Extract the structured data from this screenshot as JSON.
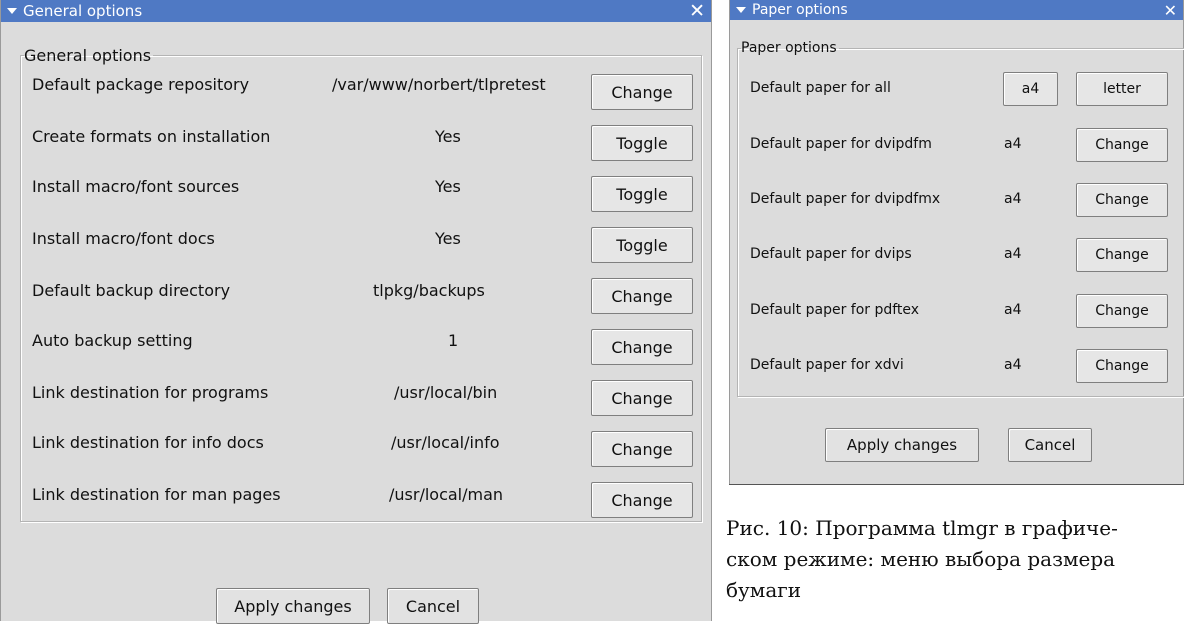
{
  "general_window": {
    "title": "General options",
    "close_glyph": "✕",
    "group_label": "General options",
    "rows": [
      {
        "label": "Default package repository",
        "value": "/var/www/norbert/tlpretest",
        "button": "Change"
      },
      {
        "label": "Create formats on installation",
        "value": "Yes",
        "button": "Toggle"
      },
      {
        "label": "Install macro/font sources",
        "value": "Yes",
        "button": "Toggle"
      },
      {
        "label": "Install macro/font docs",
        "value": "Yes",
        "button": "Toggle"
      },
      {
        "label": "Default backup directory",
        "value": "tlpkg/backups",
        "button": "Change"
      },
      {
        "label": "Auto backup setting",
        "value": "1",
        "button": "Change"
      },
      {
        "label": "Link destination for programs",
        "value": "/usr/local/bin",
        "button": "Change"
      },
      {
        "label": "Link destination for info docs",
        "value": "/usr/local/info",
        "button": "Change"
      },
      {
        "label": "Link destination for man pages",
        "value": "/usr/local/man",
        "button": "Change"
      }
    ],
    "apply_label": "Apply changes",
    "cancel_label": "Cancel"
  },
  "paper_window": {
    "title": "Paper options",
    "close_glyph": "✕",
    "group_label": "Paper options",
    "all_row": {
      "label": "Default paper for all",
      "option_a": "a4",
      "option_b": "letter"
    },
    "rows": [
      {
        "label": "Default paper for dvipdfm",
        "value": "a4",
        "button": "Change"
      },
      {
        "label": "Default paper for dvipdfmx",
        "value": "a4",
        "button": "Change"
      },
      {
        "label": "Default paper for dvips",
        "value": "a4",
        "button": "Change"
      },
      {
        "label": "Default paper for pdftex",
        "value": "a4",
        "button": "Change"
      },
      {
        "label": "Default paper for xdvi",
        "value": "a4",
        "button": "Change"
      }
    ],
    "apply_label": "Apply changes",
    "cancel_label": "Cancel"
  },
  "caption": {
    "line1": "Рис. 10: Программа tlmgr в графиче-",
    "line2": "ском режиме: меню выбора размера",
    "line3": "бумаги"
  },
  "colors": {
    "titlebar": "#4f79c4",
    "window_bg": "#dcdcdc"
  }
}
